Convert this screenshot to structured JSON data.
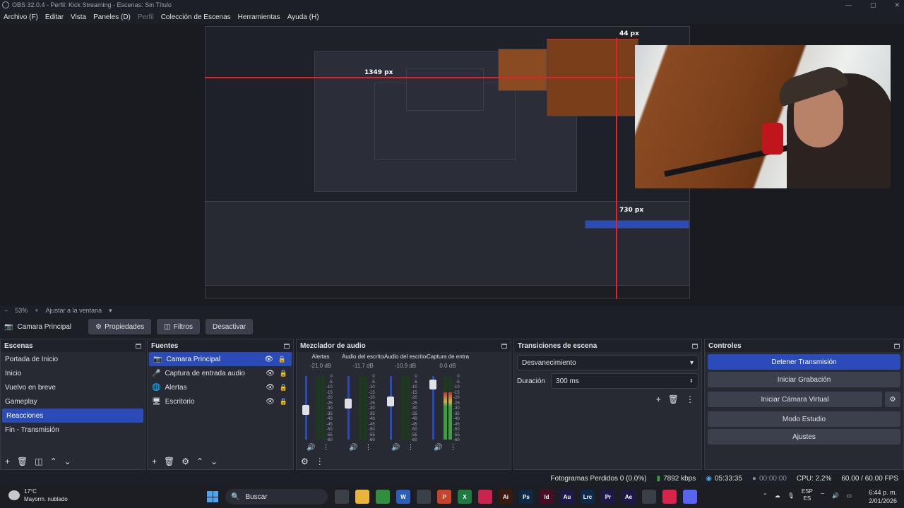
{
  "window": {
    "title": "OBS 32.0.4 - Perfil: Kick Streaming - Escenas: Sin Título",
    "controls": [
      "—",
      "▢",
      "✕"
    ]
  },
  "menu": [
    "Archivo (F)",
    "Editar",
    "Vista",
    "Paneles (D)",
    "Perfil",
    "Colección de Escenas",
    "Herramientas",
    "Ayuda (H)"
  ],
  "measurements": [
    "44 px",
    "1349 px",
    "730 px"
  ],
  "zoom": {
    "level": "53%",
    "fit_label": "Ajustar a la ventana"
  },
  "source_bar": {
    "current_source": "Camara Principal",
    "properties": "Propiedades",
    "filters": "Filtros",
    "deactivate": "Desactivar"
  },
  "scenes": {
    "title": "Escenas",
    "items": [
      "Portada de Inicio",
      "Inicio",
      "Vuelvo en breve",
      "Gameplay",
      "Reacciones",
      "Fin - Transmisión"
    ],
    "selected": "Reacciones"
  },
  "sources": {
    "title": "Fuentes",
    "items": [
      {
        "name": "Camara Principal",
        "icon": "camera-icon"
      },
      {
        "name": "Captura de entrada audio",
        "icon": "microphone-icon"
      },
      {
        "name": "Alertas",
        "icon": "globe-icon"
      },
      {
        "name": "Escritorio",
        "icon": "monitor-icon"
      }
    ]
  },
  "mixer": {
    "title": "Mezclador de audio",
    "channels": [
      {
        "name": "Alertas",
        "db": "-21.0 dB",
        "fader": 0.55,
        "level": 0.0
      },
      {
        "name": "Audio del escritorio",
        "db": "-11.7 dB",
        "fader": 0.65,
        "level": 0.0
      },
      {
        "name": "Audio del escritorio",
        "db": "-10.9 dB",
        "fader": 0.68,
        "level": 0.0
      },
      {
        "name": "Captura de entrada",
        "db": "0.0 dB",
        "fader": 0.95,
        "level": 0.75
      }
    ],
    "scale": [
      "0",
      "-5",
      "-10",
      "-15",
      "-20",
      "-25",
      "-30",
      "-35",
      "-40",
      "-45",
      "-50",
      "-55",
      "-60"
    ]
  },
  "transitions": {
    "title": "Transiciones de escena",
    "selected": "Desvanecimiento",
    "duration_label": "Duración",
    "duration_value": "300 ms"
  },
  "controls": {
    "title": "Controles",
    "stop_stream": "Detener Transmisión",
    "start_recording": "Iniciar Grabación",
    "start_virtual_cam": "Iniciar Cámara Virtual",
    "studio_mode": "Modo Estudio",
    "settings": "Ajustes"
  },
  "status": {
    "dropped_frames": "Fotogramas Perdidos 0 (0.0%)",
    "bitrate": "7892 kbps",
    "stream_time": "05:33:35",
    "record_time": "00:00:00",
    "cpu": "CPU: 2.2%",
    "fps": "60.00 / 60.00 FPS"
  },
  "taskbar": {
    "weather_temp": "17°C",
    "weather_desc": "Mayorm. nublado",
    "search": "Buscar",
    "lang": "ESP",
    "lang_sub": "ES",
    "time": "6:44 p. m.",
    "date": "2/01/2026",
    "apps": [
      {
        "label": "",
        "color": "#3b3f48"
      },
      {
        "label": "",
        "color": "#e8b53a"
      },
      {
        "label": "",
        "color": "#2f8f3f"
      },
      {
        "label": "W",
        "color": "#2b5fb8"
      },
      {
        "label": "",
        "color": "#3b3f48"
      },
      {
        "label": "P",
        "color": "#c9432b"
      },
      {
        "label": "X",
        "color": "#1f7a3f"
      },
      {
        "label": "",
        "color": "#c9254c"
      },
      {
        "label": "Ai",
        "color": "#3a1a0c"
      },
      {
        "label": "Ps",
        "color": "#0c2a48"
      },
      {
        "label": "Id",
        "color": "#4a0c24"
      },
      {
        "label": "Au",
        "color": "#1c1848"
      },
      {
        "label": "Lrc",
        "color": "#0c2a48"
      },
      {
        "label": "Pr",
        "color": "#1c1848"
      },
      {
        "label": "Ae",
        "color": "#1c1848"
      },
      {
        "label": "",
        "color": "#3b3f48"
      },
      {
        "label": "",
        "color": "#d8244c"
      },
      {
        "label": "",
        "color": "#5865f2"
      }
    ]
  }
}
